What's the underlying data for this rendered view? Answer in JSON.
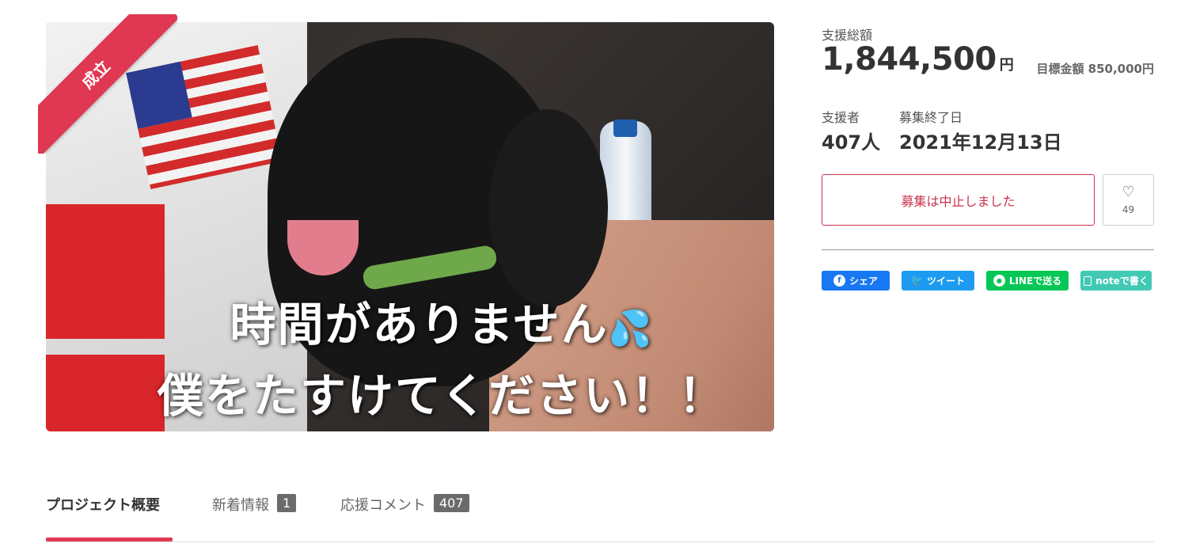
{
  "hero": {
    "caption_line1": "時間がありません",
    "caption_drops": "💦",
    "caption_line2": "僕をたすけてください！！",
    "ribbon": "成立"
  },
  "funding": {
    "total_label": "支援総額",
    "total_amount": "1,844,500",
    "total_unit": "円",
    "goal_text": "目標金額 850,000円",
    "supporters_label": "支援者",
    "supporters_value": "407人",
    "end_label": "募集終了日",
    "end_value": "2021年12月13日"
  },
  "actions": {
    "cancel_label": "募集は中止しました",
    "favorite_count": "49",
    "favorite_icon": "heart-icon"
  },
  "share": {
    "facebook": "シェア",
    "twitter": "ツイート",
    "line": "LINEで送る",
    "note": "noteで書く",
    "colors": {
      "facebook": "#1877f2",
      "twitter": "#1d9bf0",
      "line": "#06c755",
      "note": "#41c9b4"
    }
  },
  "tabs": [
    {
      "label": "プロジェクト概要"
    },
    {
      "label": "新着情報",
      "badge": "1"
    },
    {
      "label": "応援コメント",
      "badge": "407"
    }
  ],
  "colors": {
    "accent": "#e03753"
  }
}
